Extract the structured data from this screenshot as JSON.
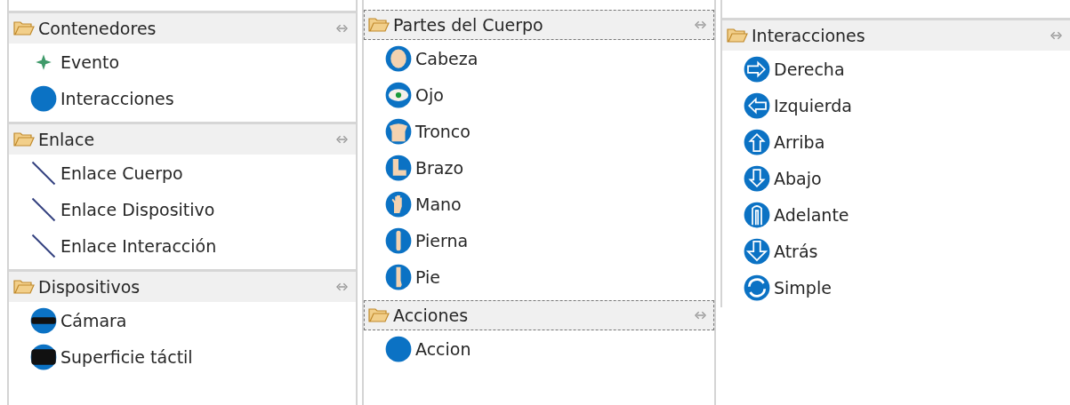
{
  "columns": [
    {
      "drawers": [
        {
          "title": "Contenedores",
          "focused": false,
          "items": [
            {
              "label": "Evento",
              "kind": "star"
            },
            {
              "label": "Interacciones",
              "kind": "circle"
            }
          ]
        },
        {
          "title": "Enlace",
          "focused": false,
          "items": [
            {
              "label": "Enlace Cuerpo",
              "kind": "line"
            },
            {
              "label": "Enlace Dispositivo",
              "kind": "line"
            },
            {
              "label": "Enlace Interacción",
              "kind": "line"
            }
          ]
        },
        {
          "title": "Dispositivos",
          "focused": false,
          "items": [
            {
              "label": "Cámara",
              "kind": "camera"
            },
            {
              "label": "Superficie táctil",
              "kind": "touchpad"
            }
          ]
        }
      ]
    },
    {
      "drawers": [
        {
          "title": "Partes del Cuerpo",
          "focused": true,
          "items": [
            {
              "label": "Cabeza",
              "kind": "head"
            },
            {
              "label": "Ojo",
              "kind": "eye"
            },
            {
              "label": "Tronco",
              "kind": "torso"
            },
            {
              "label": "Brazo",
              "kind": "arm"
            },
            {
              "label": "Mano",
              "kind": "hand"
            },
            {
              "label": "Pierna",
              "kind": "leg"
            },
            {
              "label": "Pie",
              "kind": "foot"
            }
          ]
        },
        {
          "title": "Acciones",
          "focused": true,
          "items": [
            {
              "label": "Accion",
              "kind": "circle"
            }
          ]
        }
      ]
    },
    {
      "drawers": [
        {
          "title": "Interacciones",
          "focused": false,
          "items": [
            {
              "label": "Derecha",
              "kind": "right"
            },
            {
              "label": "Izquierda",
              "kind": "left"
            },
            {
              "label": "Arriba",
              "kind": "up"
            },
            {
              "label": "Abajo",
              "kind": "down"
            },
            {
              "label": "Adelante",
              "kind": "forward"
            },
            {
              "label": "Atrás",
              "kind": "back"
            },
            {
              "label": "Simple",
              "kind": "cycle"
            }
          ]
        }
      ]
    }
  ]
}
